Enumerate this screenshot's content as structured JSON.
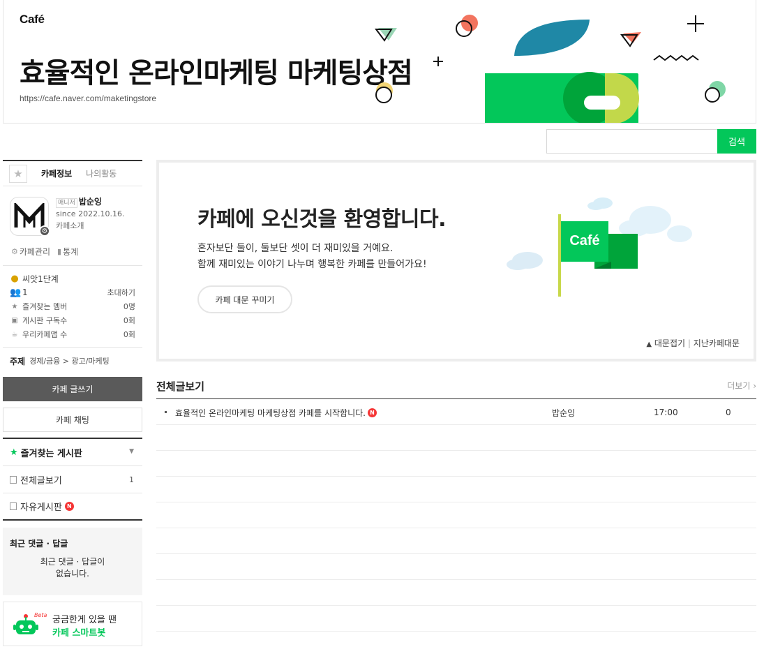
{
  "banner": {
    "logo": "Café",
    "title": "효율적인 온라인마케팅 마케팅상점",
    "url": "https://cafe.naver.com/maketingstore"
  },
  "search": {
    "placeholder": "",
    "button": "검색"
  },
  "sidebar": {
    "tabs": [
      "카페정보",
      "나의활동"
    ],
    "profile": {
      "role": "매니저",
      "nickname": "밥순잉",
      "since": "since 2022.10.16.",
      "intro_link": "카페소개"
    },
    "admin": {
      "manage": "카페관리",
      "stats": "통계"
    },
    "level": "씨앗1단계",
    "members": "1",
    "invite": "초대하기",
    "stat_rows": [
      {
        "label": "즐겨찾는 멤버",
        "value": "0명"
      },
      {
        "label": "게시판 구독수",
        "value": "0회"
      },
      {
        "label": "우리카페앱 수",
        "value": "0회"
      }
    ],
    "subject": {
      "label": "주제",
      "value": "경제/금융 > 광고/마케팅"
    },
    "write_button": "카페 글쓰기",
    "chat_button": "카페 채팅",
    "fav_board": "즐겨찾는 게시판",
    "menu": [
      {
        "label": "전체글보기",
        "count": "1"
      },
      {
        "label": "자유게시판",
        "count": ""
      }
    ],
    "recent": {
      "title": "최근 댓글 · 답글",
      "empty_line1": "최근 댓글 · 답글이",
      "empty_line2": "없습니다."
    },
    "bot": {
      "beta": "Beta",
      "line1": "궁금한게 있을 땐",
      "line2": "카페 스마트봇"
    }
  },
  "welcome": {
    "heading": "카페에 오신것을 환영합니다.",
    "line1": "혼자보단 둘이, 둘보단 셋이 더 재미있을 거예요.",
    "line2": "함께 재미있는 이야기 나누며 행복한 카페를 만들어가요!",
    "decorate_button": "카페 대문 꾸미기",
    "fold": "대문접기",
    "past": "지난카페대문",
    "flag_logo": "Café"
  },
  "articles": {
    "title": "전체글보기",
    "more": "더보기",
    "rows": [
      {
        "subject": "효율적인 온라인마케팅 마케팅상점 카페를 시작합니다.",
        "author": "밥순잉",
        "time": "17:00",
        "views": "0"
      }
    ]
  },
  "colors": {
    "accent": "#03c75a",
    "new_badge": "#f53535"
  }
}
